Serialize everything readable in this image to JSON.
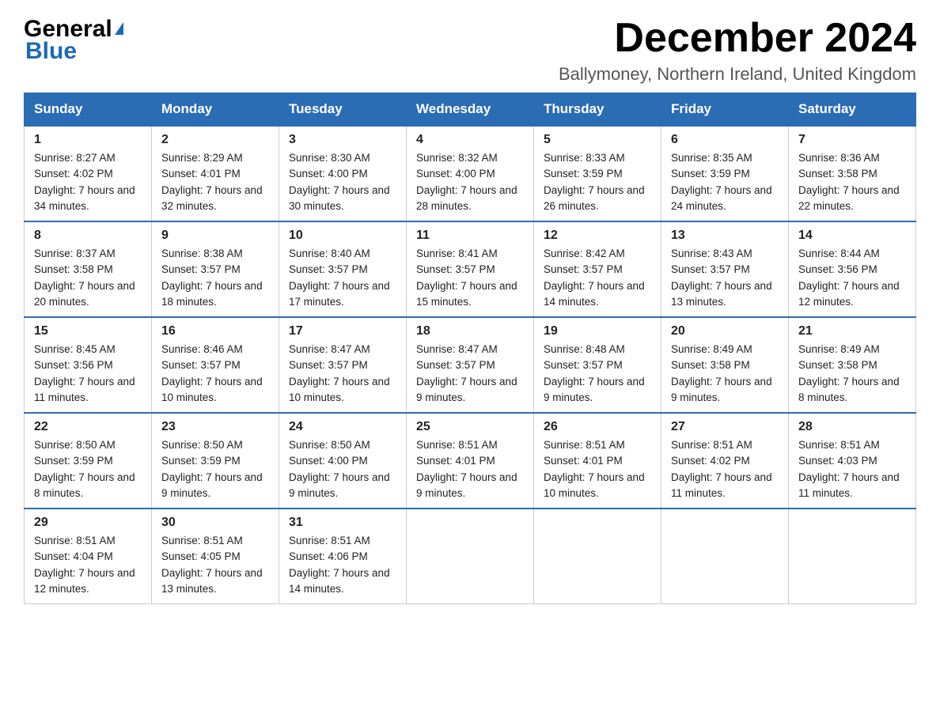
{
  "header": {
    "logo_line1": "General",
    "logo_line2": "Blue",
    "main_title": "December 2024",
    "subtitle": "Ballymoney, Northern Ireland, United Kingdom"
  },
  "days_of_week": [
    "Sunday",
    "Monday",
    "Tuesday",
    "Wednesday",
    "Thursday",
    "Friday",
    "Saturday"
  ],
  "weeks": [
    [
      {
        "day": "1",
        "sunrise": "Sunrise: 8:27 AM",
        "sunset": "Sunset: 4:02 PM",
        "daylight": "Daylight: 7 hours and 34 minutes."
      },
      {
        "day": "2",
        "sunrise": "Sunrise: 8:29 AM",
        "sunset": "Sunset: 4:01 PM",
        "daylight": "Daylight: 7 hours and 32 minutes."
      },
      {
        "day": "3",
        "sunrise": "Sunrise: 8:30 AM",
        "sunset": "Sunset: 4:00 PM",
        "daylight": "Daylight: 7 hours and 30 minutes."
      },
      {
        "day": "4",
        "sunrise": "Sunrise: 8:32 AM",
        "sunset": "Sunset: 4:00 PM",
        "daylight": "Daylight: 7 hours and 28 minutes."
      },
      {
        "day": "5",
        "sunrise": "Sunrise: 8:33 AM",
        "sunset": "Sunset: 3:59 PM",
        "daylight": "Daylight: 7 hours and 26 minutes."
      },
      {
        "day": "6",
        "sunrise": "Sunrise: 8:35 AM",
        "sunset": "Sunset: 3:59 PM",
        "daylight": "Daylight: 7 hours and 24 minutes."
      },
      {
        "day": "7",
        "sunrise": "Sunrise: 8:36 AM",
        "sunset": "Sunset: 3:58 PM",
        "daylight": "Daylight: 7 hours and 22 minutes."
      }
    ],
    [
      {
        "day": "8",
        "sunrise": "Sunrise: 8:37 AM",
        "sunset": "Sunset: 3:58 PM",
        "daylight": "Daylight: 7 hours and 20 minutes."
      },
      {
        "day": "9",
        "sunrise": "Sunrise: 8:38 AM",
        "sunset": "Sunset: 3:57 PM",
        "daylight": "Daylight: 7 hours and 18 minutes."
      },
      {
        "day": "10",
        "sunrise": "Sunrise: 8:40 AM",
        "sunset": "Sunset: 3:57 PM",
        "daylight": "Daylight: 7 hours and 17 minutes."
      },
      {
        "day": "11",
        "sunrise": "Sunrise: 8:41 AM",
        "sunset": "Sunset: 3:57 PM",
        "daylight": "Daylight: 7 hours and 15 minutes."
      },
      {
        "day": "12",
        "sunrise": "Sunrise: 8:42 AM",
        "sunset": "Sunset: 3:57 PM",
        "daylight": "Daylight: 7 hours and 14 minutes."
      },
      {
        "day": "13",
        "sunrise": "Sunrise: 8:43 AM",
        "sunset": "Sunset: 3:57 PM",
        "daylight": "Daylight: 7 hours and 13 minutes."
      },
      {
        "day": "14",
        "sunrise": "Sunrise: 8:44 AM",
        "sunset": "Sunset: 3:56 PM",
        "daylight": "Daylight: 7 hours and 12 minutes."
      }
    ],
    [
      {
        "day": "15",
        "sunrise": "Sunrise: 8:45 AM",
        "sunset": "Sunset: 3:56 PM",
        "daylight": "Daylight: 7 hours and 11 minutes."
      },
      {
        "day": "16",
        "sunrise": "Sunrise: 8:46 AM",
        "sunset": "Sunset: 3:57 PM",
        "daylight": "Daylight: 7 hours and 10 minutes."
      },
      {
        "day": "17",
        "sunrise": "Sunrise: 8:47 AM",
        "sunset": "Sunset: 3:57 PM",
        "daylight": "Daylight: 7 hours and 10 minutes."
      },
      {
        "day": "18",
        "sunrise": "Sunrise: 8:47 AM",
        "sunset": "Sunset: 3:57 PM",
        "daylight": "Daylight: 7 hours and 9 minutes."
      },
      {
        "day": "19",
        "sunrise": "Sunrise: 8:48 AM",
        "sunset": "Sunset: 3:57 PM",
        "daylight": "Daylight: 7 hours and 9 minutes."
      },
      {
        "day": "20",
        "sunrise": "Sunrise: 8:49 AM",
        "sunset": "Sunset: 3:58 PM",
        "daylight": "Daylight: 7 hours and 9 minutes."
      },
      {
        "day": "21",
        "sunrise": "Sunrise: 8:49 AM",
        "sunset": "Sunset: 3:58 PM",
        "daylight": "Daylight: 7 hours and 8 minutes."
      }
    ],
    [
      {
        "day": "22",
        "sunrise": "Sunrise: 8:50 AM",
        "sunset": "Sunset: 3:59 PM",
        "daylight": "Daylight: 7 hours and 8 minutes."
      },
      {
        "day": "23",
        "sunrise": "Sunrise: 8:50 AM",
        "sunset": "Sunset: 3:59 PM",
        "daylight": "Daylight: 7 hours and 9 minutes."
      },
      {
        "day": "24",
        "sunrise": "Sunrise: 8:50 AM",
        "sunset": "Sunset: 4:00 PM",
        "daylight": "Daylight: 7 hours and 9 minutes."
      },
      {
        "day": "25",
        "sunrise": "Sunrise: 8:51 AM",
        "sunset": "Sunset: 4:01 PM",
        "daylight": "Daylight: 7 hours and 9 minutes."
      },
      {
        "day": "26",
        "sunrise": "Sunrise: 8:51 AM",
        "sunset": "Sunset: 4:01 PM",
        "daylight": "Daylight: 7 hours and 10 minutes."
      },
      {
        "day": "27",
        "sunrise": "Sunrise: 8:51 AM",
        "sunset": "Sunset: 4:02 PM",
        "daylight": "Daylight: 7 hours and 11 minutes."
      },
      {
        "day": "28",
        "sunrise": "Sunrise: 8:51 AM",
        "sunset": "Sunset: 4:03 PM",
        "daylight": "Daylight: 7 hours and 11 minutes."
      }
    ],
    [
      {
        "day": "29",
        "sunrise": "Sunrise: 8:51 AM",
        "sunset": "Sunset: 4:04 PM",
        "daylight": "Daylight: 7 hours and 12 minutes."
      },
      {
        "day": "30",
        "sunrise": "Sunrise: 8:51 AM",
        "sunset": "Sunset: 4:05 PM",
        "daylight": "Daylight: 7 hours and 13 minutes."
      },
      {
        "day": "31",
        "sunrise": "Sunrise: 8:51 AM",
        "sunset": "Sunset: 4:06 PM",
        "daylight": "Daylight: 7 hours and 14 minutes."
      },
      null,
      null,
      null,
      null
    ]
  ]
}
